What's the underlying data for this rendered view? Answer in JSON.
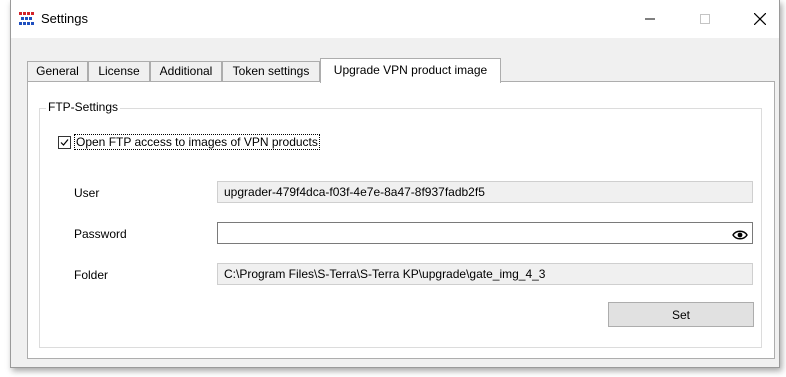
{
  "window": {
    "title": "Settings",
    "icon": "app-logo-icon",
    "controls": {
      "minimize_icon": "minimize-icon",
      "maximize_icon": "maximize-icon",
      "close_icon": "close-icon"
    }
  },
  "tabs": [
    {
      "label": "General",
      "active": false
    },
    {
      "label": "License",
      "active": false
    },
    {
      "label": "Additional",
      "active": false
    },
    {
      "label": "Token settings",
      "active": false
    },
    {
      "label": "Upgrade VPN product image",
      "active": true
    }
  ],
  "ftp_group": {
    "legend": "FTP-Settings",
    "checkbox": {
      "label": "Open FTP access to images of VPN products",
      "checked": true
    },
    "user": {
      "label": "User",
      "value": "upgrader-479f4dca-f03f-4e7e-8a47-8f937fadb2f5"
    },
    "password": {
      "label": "Password",
      "value": "",
      "icon": "eye-icon"
    },
    "folder": {
      "label": "Folder",
      "value": "C:\\Program Files\\S-Terra\\S-Terra KP\\upgrade\\gate_img_4_3"
    },
    "set_button": "Set"
  }
}
